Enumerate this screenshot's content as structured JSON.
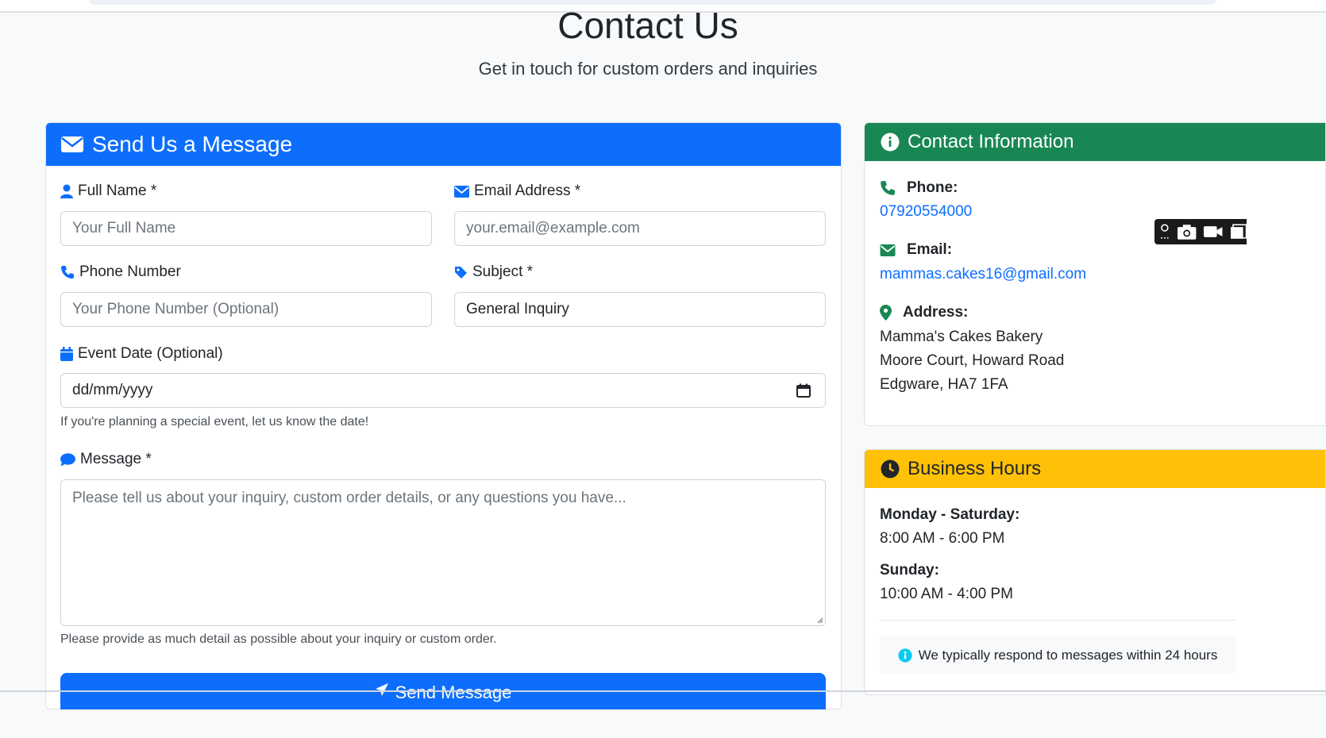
{
  "header": {
    "title": "Contact Us",
    "subtitle": "Get in touch for custom orders and inquiries"
  },
  "form": {
    "card_title": "Send Us a Message",
    "full_name_label": "Full Name *",
    "full_name_placeholder": "Your Full Name",
    "email_label": "Email Address *",
    "email_placeholder": "your.email@example.com",
    "phone_label": "Phone Number",
    "phone_placeholder": "Your Phone Number (Optional)",
    "subject_label": "Subject *",
    "subject_value": "General Inquiry",
    "event_label": "Event Date (Optional)",
    "event_value": "dd/mm/yyyy",
    "event_help": "If you're planning a special event, let us know the date!",
    "message_label": "Message *",
    "message_placeholder": "Please tell us about your inquiry, custom order details, or any questions you have...",
    "message_help": "Please provide as much detail as possible about your inquiry or custom order.",
    "send_label": "Send Message"
  },
  "contact_info": {
    "card_title": "Contact Information",
    "phone_label": "Phone:",
    "phone_value": "07920554000",
    "email_label": "Email:",
    "email_value": "mammas.cakes16@gmail.com",
    "address_label": "Address:",
    "address_line1": "Mamma's Cakes Bakery",
    "address_line2": "Moore Court, Howard Road",
    "address_line3": "Edgware, HA7 1FA"
  },
  "business_hours": {
    "card_title": "Business Hours",
    "weekday_label": "Monday - Saturday:",
    "weekday_hours": "8:00 AM - 6:00 PM",
    "sunday_label": "Sunday:",
    "sunday_hours": "10:00 AM - 4:00 PM",
    "note": "We typically respond to messages within 24 hours"
  },
  "colors": {
    "primary": "#0d6efd",
    "success": "#198754",
    "warning": "#ffc107"
  }
}
